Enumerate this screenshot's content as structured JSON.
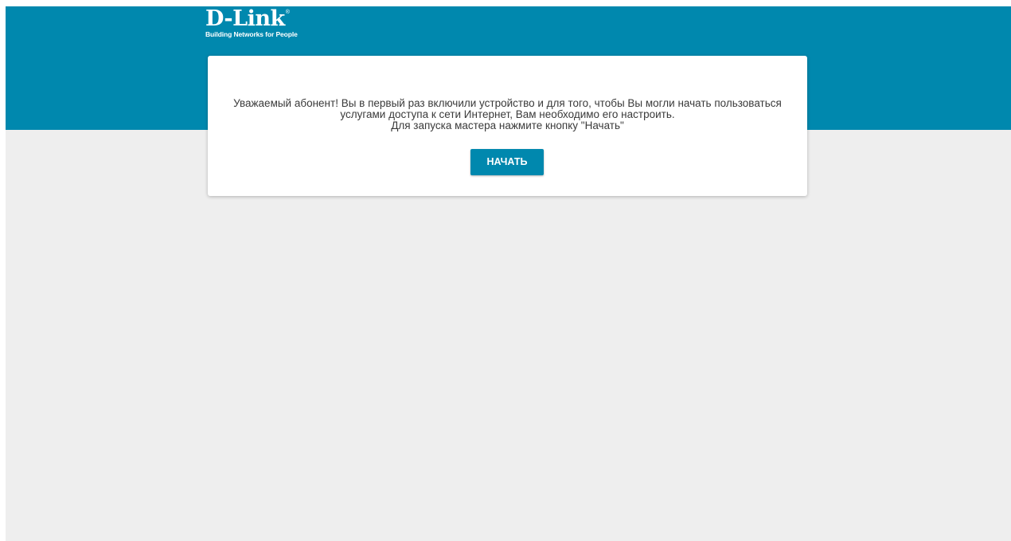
{
  "header": {
    "logo_text": "D-Link",
    "logo_registered": "®",
    "tagline": "Building Networks for People"
  },
  "welcome": {
    "line1": "Уважаемый абонент! Вы в первый раз включили устройство и для того, чтобы Вы могли начать пользоваться",
    "line2": "услугами доступа к сети Интернет, Вам необходимо его настроить.",
    "line3": "Для запуска мастера нажмите кнопку \"Начать\"",
    "start_button_label": "НАЧАТЬ"
  },
  "colors": {
    "brand": "#0088ae",
    "background": "#eeeeee",
    "card": "#ffffff"
  }
}
